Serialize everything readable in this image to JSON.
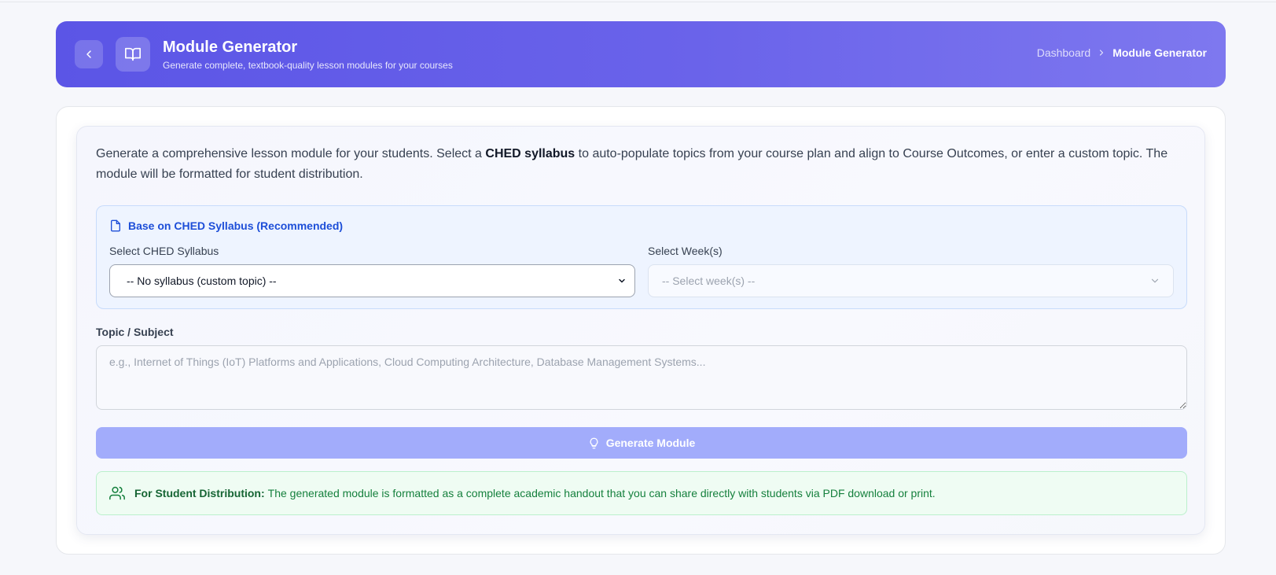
{
  "header": {
    "title": "Module Generator",
    "subtitle": "Generate complete, textbook-quality lesson modules for your courses",
    "breadcrumb": {
      "link": "Dashboard",
      "current": "Module Generator"
    }
  },
  "intro": {
    "before": "Generate a comprehensive lesson module for your students. Select a ",
    "highlight": "CHED syllabus",
    "after": " to auto-populate topics from your course plan and align to Course Outcomes, or enter a custom topic. The module will be formatted for student distribution."
  },
  "ched": {
    "heading": "Base on CHED Syllabus (Recommended)",
    "syllabus_label": "Select CHED Syllabus",
    "syllabus_value": "-- No syllabus (custom topic) --",
    "week_label": "Select Week(s)",
    "week_value": "-- Select week(s) --"
  },
  "topic": {
    "label": "Topic / Subject",
    "placeholder": "e.g., Internet of Things (IoT) Platforms and Applications, Cloud Computing Architecture, Database Management Systems..."
  },
  "generate_label": "Generate Module",
  "distribution": {
    "title": "For Student Distribution:",
    "text": "The generated module is formatted as a complete academic handout that you can share directly with students via PDF download or print."
  },
  "colors": {
    "header_start": "#5b55e6",
    "header_end": "#7e78ef",
    "generate_button": "#a2acfb",
    "ched_heading": "#1d4ed8",
    "distribution_text": "#15803d"
  },
  "icons": {
    "back": "chevron-left-icon",
    "header_badge": "book-icon",
    "breadcrumb_sep": "chevron-right-icon",
    "ched": "file-icon",
    "week_dropdown": "chevron-down-icon",
    "syllabus_dropdown": "chevron-down-icon",
    "generate": "lightbulb-icon",
    "distribution": "users-icon"
  }
}
